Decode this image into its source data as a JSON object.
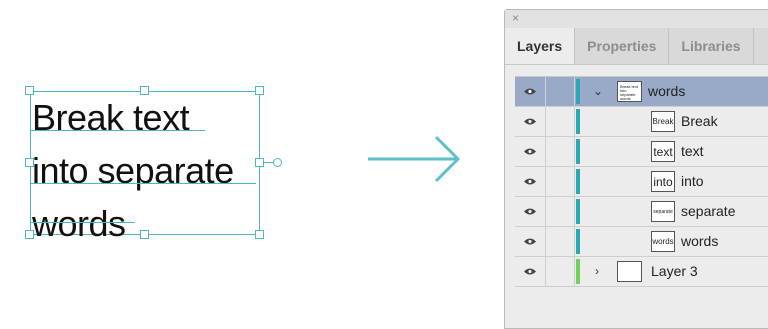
{
  "canvas": {
    "text_lines": [
      "Break text",
      "into separate",
      "words"
    ],
    "selection_color": "#4fb7c3"
  },
  "arrow": {
    "icon": "arrow-right-icon",
    "color": "#5fbfc8"
  },
  "panel": {
    "close_icon": "×",
    "tabs": [
      {
        "label": "Layers",
        "active": true
      },
      {
        "label": "Properties",
        "active": false
      },
      {
        "label": "Libraries",
        "active": false
      }
    ],
    "layers": [
      {
        "name": "words",
        "type": "group",
        "expanded": true,
        "selected": true,
        "visible": true,
        "color": "#2aa9b3",
        "thumb_text": "Break text into separate words"
      },
      {
        "name": "Break",
        "type": "item",
        "selected": false,
        "visible": true,
        "color": "#2aa9b3",
        "thumb_text": "Break"
      },
      {
        "name": "text",
        "type": "item",
        "selected": false,
        "visible": true,
        "color": "#2aa9b3",
        "thumb_text": "text"
      },
      {
        "name": "into",
        "type": "item",
        "selected": false,
        "visible": true,
        "color": "#2aa9b3",
        "thumb_text": "into"
      },
      {
        "name": "separate",
        "type": "item",
        "selected": false,
        "visible": true,
        "color": "#2aa9b3",
        "thumb_text": "separate"
      },
      {
        "name": "words",
        "type": "item",
        "selected": false,
        "visible": true,
        "color": "#2aa9b3",
        "thumb_text": "words"
      },
      {
        "name": "Layer 3",
        "type": "layer",
        "expanded": false,
        "selected": false,
        "visible": true,
        "color": "#6fd35a",
        "thumb_text": ""
      }
    ]
  }
}
